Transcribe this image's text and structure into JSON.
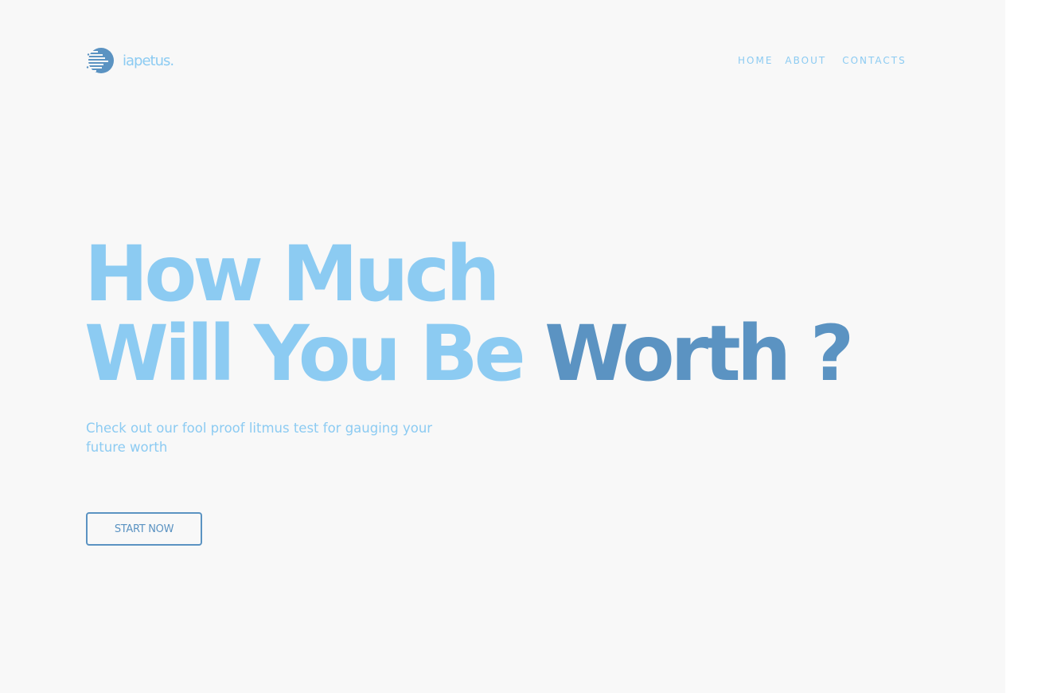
{
  "brand": {
    "name": "iapetus.",
    "logo_icon": "striped-circle-logo-icon",
    "logo_color": "#5b93c2"
  },
  "nav": {
    "items": [
      {
        "label": "HOME"
      },
      {
        "label": "ABOUT"
      },
      {
        "label": "CONTACTS"
      }
    ]
  },
  "hero": {
    "line1": "How Much",
    "line2_part1": "Will You Be ",
    "line2_accent": "Worth ?",
    "subtitle": "Check out our fool proof litmus test for gauging your future worth",
    "cta_label": "START NOW"
  },
  "colors": {
    "background": "#f8f8f8",
    "light_blue": "#8ccbf2",
    "dark_blue": "#5b93c2"
  }
}
